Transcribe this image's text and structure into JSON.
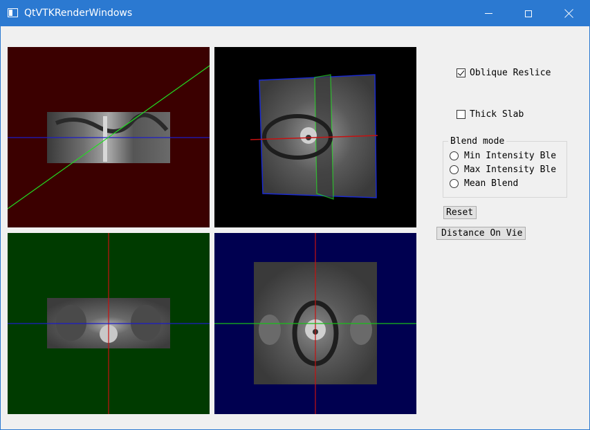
{
  "window": {
    "title": "QtVTKRenderWindows",
    "border_color": "#2b79d1",
    "controls": [
      "minimize-icon",
      "maximize-icon",
      "close-icon"
    ]
  },
  "views": {
    "sagittal": {
      "background": "#3b0000",
      "cursor_colors": [
        "#00e000",
        "#0000d0"
      ]
    },
    "oblique_3d": {
      "background": "#000000",
      "plane_colors": [
        "#0000d0",
        "#00e000",
        "#c00000"
      ]
    },
    "coronal": {
      "background": "#003b00",
      "cursor_colors": [
        "#c00000",
        "#0000d0"
      ]
    },
    "axial": {
      "background": "#000050",
      "cursor_colors": [
        "#c00000",
        "#00c000"
      ]
    }
  },
  "controls": {
    "oblique_reslice": {
      "label": "Oblique Reslice",
      "checked": true
    },
    "thick_slab": {
      "label": "Thick Slab",
      "checked": false
    },
    "blend_mode": {
      "title": "Blend mode",
      "options": [
        "Min Intensity Blend",
        "Max Intensity Blend",
        "Mean Blend"
      ],
      "visible_options": [
        "Min Intensity Ble",
        "Max Intensity Ble",
        "Mean Blend"
      ]
    },
    "reset_label": "Reset",
    "distance_label": "Distance On Vie"
  }
}
